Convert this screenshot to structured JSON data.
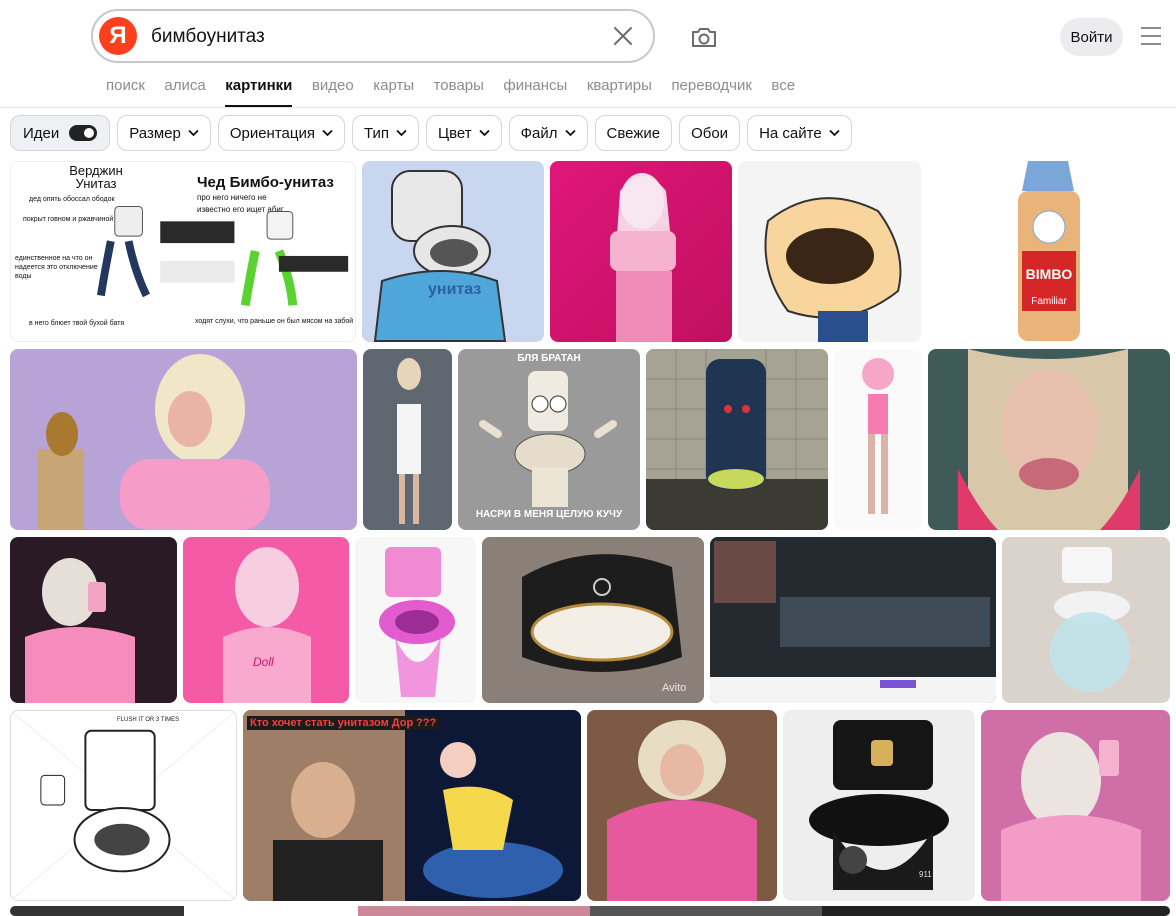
{
  "search": {
    "logo": "Я",
    "query": "бимбоунитаз"
  },
  "header": {
    "login_label": "Войти"
  },
  "nav": {
    "tabs": [
      {
        "label": "поиск"
      },
      {
        "label": "алиса"
      },
      {
        "label": "картинки",
        "active": true
      },
      {
        "label": "видео"
      },
      {
        "label": "карты"
      },
      {
        "label": "товары"
      },
      {
        "label": "финансы"
      },
      {
        "label": "квартиры"
      },
      {
        "label": "переводчик"
      },
      {
        "label": "все"
      }
    ]
  },
  "filters": {
    "ideas_label": "Идеи",
    "ideas_enabled": true,
    "items": [
      {
        "label": "Размер",
        "dropdown": true
      },
      {
        "label": "Ориентация",
        "dropdown": true
      },
      {
        "label": "Тип",
        "dropdown": true
      },
      {
        "label": "Цвет",
        "dropdown": true
      },
      {
        "label": "Файл",
        "dropdown": true
      },
      {
        "label": "Свежие",
        "dropdown": false
      },
      {
        "label": "Обои",
        "dropdown": false
      },
      {
        "label": "На сайте",
        "dropdown": true
      }
    ]
  },
  "results": {
    "meme_virgin_title": "Верджин Унитаз",
    "meme_chad_title": "Чед Бимбо-унитаз",
    "meme_chad_caption": "про него ничего не известно его ищет абиг",
    "meme_virgin_caption_1": "дед опять обоссал ободок",
    "meme_virgin_caption_2": "покрыт говном и ржавчиной",
    "meme_virgin_caption_3": "единственное на что он надеется это отключение воды",
    "meme_virgin_caption_4": "в него блюет твой бухой батя",
    "meme_chad_caption_2": "ходят слухи, что раньше он был мясом на забой",
    "toilet_shirt_text": "унитаз",
    "bread_brand": "BIMBO",
    "bread_variant": "Familiar",
    "bratan_top": "БЛЯ БРАТАН",
    "bratan_bottom": "НАСРИ В МЕНЯ ЦЕЛУЮ КУЧУ",
    "doll_shirt_text": "Doll",
    "cartoon_sign": "FLUSH IT OR 3 TIMES",
    "reel_title": "Кто хочет стать унитазом Доры",
    "reel_badge": "???",
    "avito_label": "Avito",
    "porsche_badge": "911"
  },
  "colors": {
    "brand_red": "#fc3f1d",
    "active_tab": "#111111",
    "inactive_tab": "#8b8c91"
  }
}
